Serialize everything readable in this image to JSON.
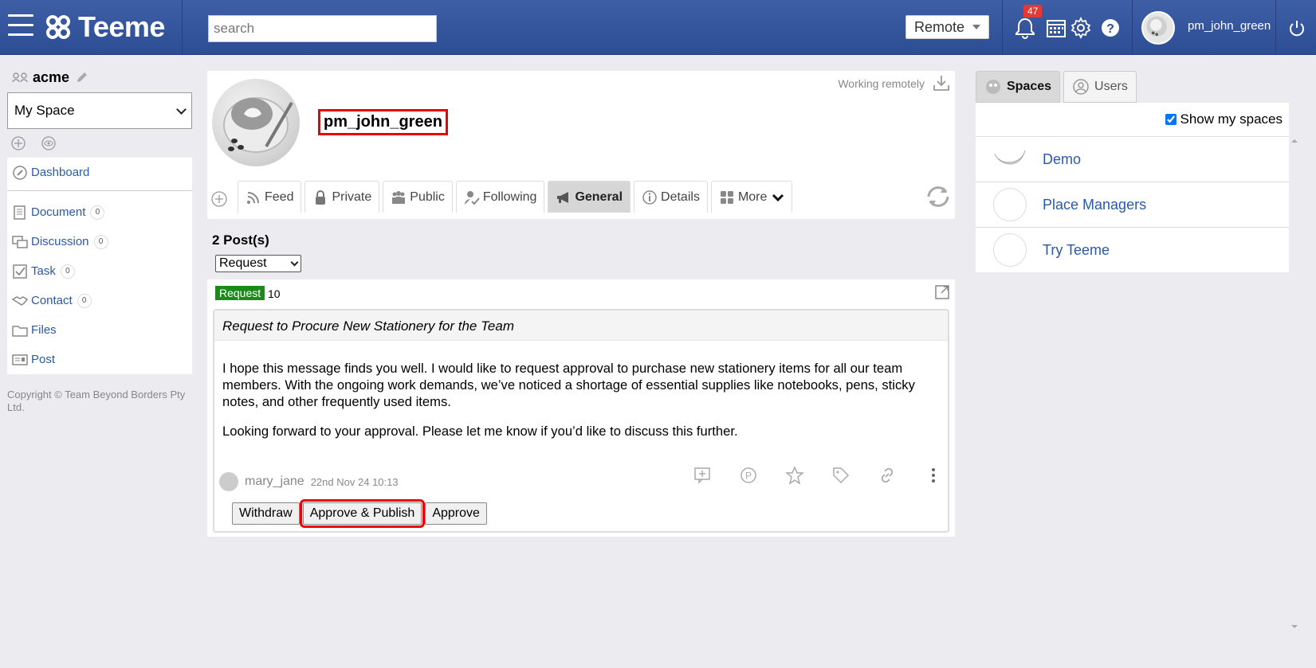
{
  "header": {
    "logo_text": "Teeme",
    "search_placeholder": "search",
    "location_select": "Remote",
    "notification_count": "47",
    "username": "pm_john_green"
  },
  "sidebar": {
    "org_name": "acme",
    "space_select": "My Space",
    "dashboard": "Dashboard",
    "items": [
      {
        "label": "Document",
        "count": "0"
      },
      {
        "label": "Discussion",
        "count": "0"
      },
      {
        "label": "Task",
        "count": "0"
      },
      {
        "label": "Contact",
        "count": "0"
      },
      {
        "label": "Files"
      },
      {
        "label": "Post"
      }
    ],
    "copyright": "Copyright © Team Beyond Borders Pty Ltd."
  },
  "profile": {
    "name": "pm_john_green",
    "status": "Working remotely",
    "tabs": [
      "Feed",
      "Private",
      "Public",
      "Following",
      "General",
      "Details",
      "More"
    ],
    "active_tab": "General"
  },
  "posts": {
    "count_label": "2 Post(s)",
    "filter": "Request",
    "post": {
      "badge": "Request",
      "number": "10",
      "title": "Request to Procure New Stationery for the Team",
      "paragraphs": [
        "I hope this message finds you well. I would like to request approval to purchase new stationery items for all our team members. With the ongoing work demands, we’ve noticed a shortage of essential supplies like notebooks, pens, sticky notes, and other frequently used items.",
        "Looking forward to your approval. Please let me know if you’d like to discuss this further."
      ],
      "author": "mary_jane",
      "date": "22nd Nov 24 10:13",
      "buttons": [
        "Withdraw",
        "Approve & Publish",
        "Approve"
      ]
    }
  },
  "right_panel": {
    "tabs": [
      "Spaces",
      "Users"
    ],
    "show_my_spaces": "Show my spaces",
    "spaces": [
      "Demo",
      "Place Managers",
      "Try Teeme"
    ]
  },
  "colors": {
    "header_bg": "#2f5096",
    "link": "#2b59a8",
    "badge_green": "#1a8a1a",
    "highlight_red": "#e00000",
    "notification_red": "#e53935"
  }
}
